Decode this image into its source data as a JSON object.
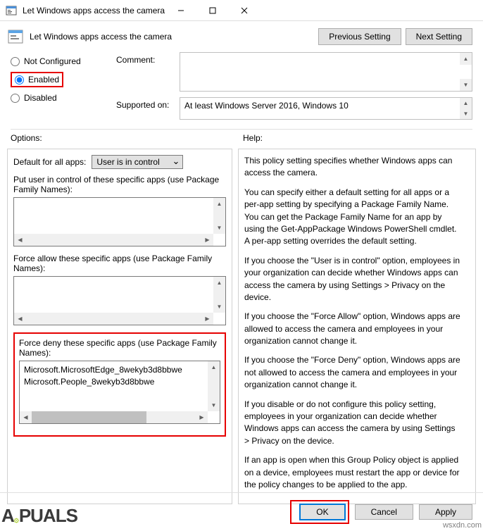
{
  "titlebar": {
    "title": "Let Windows apps access the camera"
  },
  "header": {
    "title": "Let Windows apps access the camera",
    "prev_btn": "Previous Setting",
    "next_btn": "Next Setting"
  },
  "radio": {
    "not_configured": "Not Configured",
    "enabled": "Enabled",
    "disabled": "Disabled",
    "selected": "enabled"
  },
  "fields": {
    "comment_label": "Comment:",
    "supported_label": "Supported on:",
    "supported_value": "At least Windows Server 2016, Windows 10"
  },
  "section": {
    "options_label": "Options:",
    "help_label": "Help:"
  },
  "options": {
    "default_label": "Default for all apps:",
    "default_value": "User is in control",
    "put_user_label": "Put user in control of these specific apps (use Package Family Names):",
    "force_allow_label": "Force allow these specific apps (use Package Family Names):",
    "force_deny_label": "Force deny these specific apps (use Package Family Names):",
    "force_deny_values": [
      "Microsoft.MicrosoftEdge_8wekyb3d8bbwe",
      "Microsoft.People_8wekyb3d8bbwe"
    ]
  },
  "help_paragraphs": [
    "This policy setting specifies whether Windows apps can access the camera.",
    "You can specify either a default setting for all apps or a per-app setting by specifying a Package Family Name. You can get the Package Family Name for an app by using the Get-AppPackage Windows PowerShell cmdlet. A per-app setting overrides the default setting.",
    "If you choose the \"User is in control\" option, employees in your organization can decide whether Windows apps can access the camera by using Settings > Privacy on the device.",
    "If you choose the \"Force Allow\" option, Windows apps are allowed to access the camera and employees in your organization cannot change it.",
    "If you choose the \"Force Deny\" option, Windows apps are not allowed to access the camera and employees in your organization cannot change it.",
    "If you disable or do not configure this policy setting, employees in your organization can decide whether Windows apps can access the camera by using Settings > Privacy on the device.",
    "If an app is open when this Group Policy object is applied on a device, employees must restart the app or device for the policy changes to be applied to the app."
  ],
  "footer": {
    "ok": "OK",
    "cancel": "Cancel",
    "apply": "Apply"
  },
  "watermark": {
    "logo": "APPUALS",
    "site": "wsxdn.com"
  }
}
